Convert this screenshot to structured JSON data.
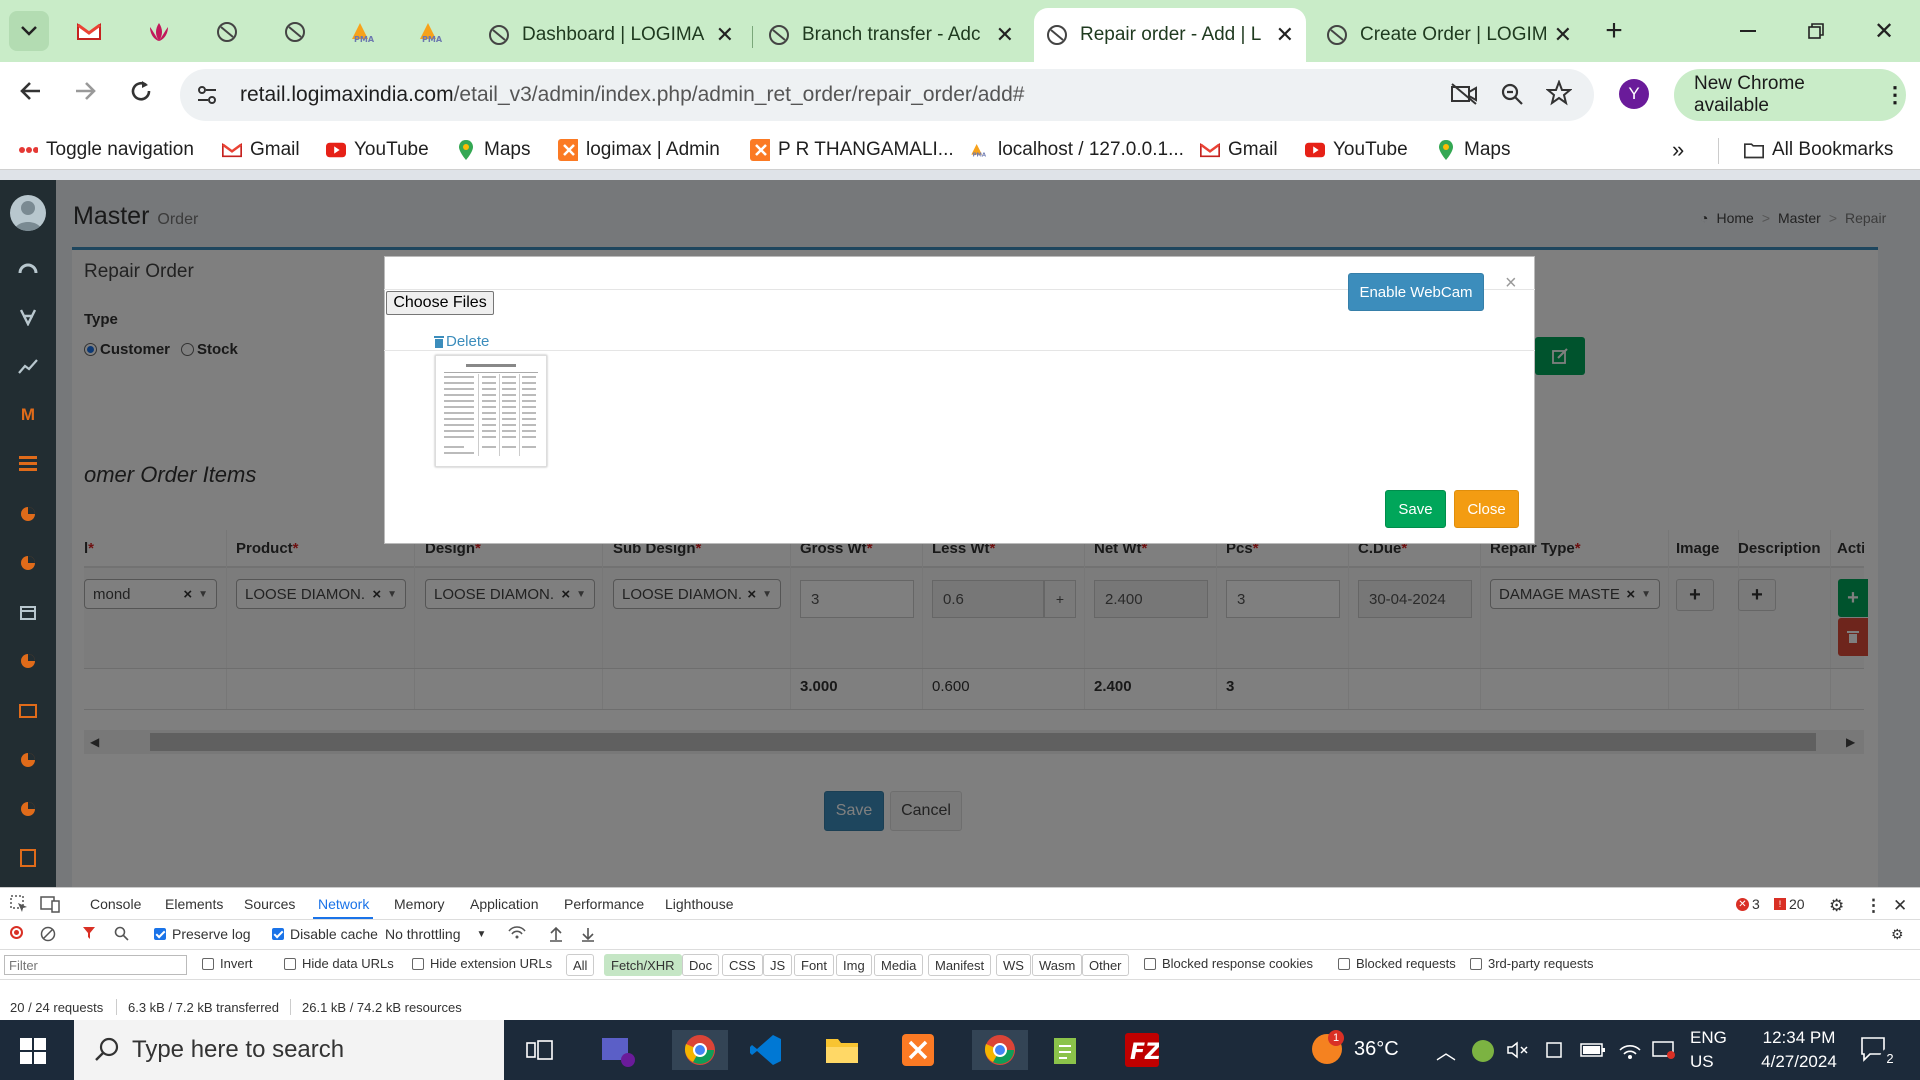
{
  "browser": {
    "tabs": [
      {
        "label": "Dashboard | LOGIMA",
        "active": false
      },
      {
        "label": "Branch transfer - Adc",
        "active": false
      },
      {
        "label": "Repair order - Add | L",
        "active": true
      },
      {
        "label": "Create Order | LOGIM",
        "active": false
      }
    ],
    "url_host": "retail.logimaxindia.com",
    "url_path": "/etail_v3/admin/index.php/admin_ret_order/repair_order/add#",
    "profile_initial": "Y",
    "new_chrome_label": "New Chrome available",
    "bookmarks": [
      "Toggle navigation",
      "Gmail",
      "YouTube",
      "Maps",
      "logimax | Admin",
      "P R THANGAMALI...",
      "localhost / 127.0.0.1...",
      "Gmail",
      "YouTube",
      "Maps"
    ],
    "all_bookmarks_label": "All Bookmarks",
    "colors": {
      "tabbar": "#c9ecc8",
      "accent": "#3c8dbc"
    }
  },
  "page": {
    "title": "Master",
    "subtitle": "Order",
    "breadcrumb": [
      "Home",
      "Master",
      "Repair"
    ],
    "box_title": "Repair Order",
    "type_label": "Type",
    "type_options": [
      "Customer",
      "Stock"
    ],
    "type_selected": "Customer",
    "items_title": "omer Order Items",
    "save_label": "Save",
    "cancel_label": "Cancel"
  },
  "table": {
    "headers": [
      {
        "label": "l",
        "required": true
      },
      {
        "label": "Product",
        "required": true
      },
      {
        "label": "Design",
        "required": true
      },
      {
        "label": "Sub Design",
        "required": true
      },
      {
        "label": "Gross Wt",
        "required": true
      },
      {
        "label": "Less Wt",
        "required": true
      },
      {
        "label": "Net Wt",
        "required": true
      },
      {
        "label": "Pcs",
        "required": true
      },
      {
        "label": "C.Due",
        "required": true
      },
      {
        "label": "Repair Type",
        "required": true
      },
      {
        "label": "Image",
        "required": false
      },
      {
        "label": "Description",
        "required": false
      },
      {
        "label": "Acti",
        "required": false
      }
    ],
    "row": {
      "material": "mond",
      "product": "LOOSE DIAMON...",
      "design": "LOOSE DIAMON...",
      "sub_design": "LOOSE DIAMON...",
      "gross_wt": "3",
      "less_wt": "0.6",
      "net_wt": "2.400",
      "pcs": "3",
      "c_due": "30-04-2024",
      "repair_type": "DAMAGE MASTER"
    },
    "totals": {
      "gross_wt": "3.000",
      "less_wt": "0.600",
      "net_wt": "2.400",
      "pcs": "3"
    }
  },
  "modal": {
    "choose_files_label": "Choose Files",
    "enable_webcam_label": "Enable WebCam",
    "close_x": "×",
    "delete_label": "Delete",
    "save_label": "Save",
    "close_label": "Close"
  },
  "devtools": {
    "tabs": [
      "Console",
      "Elements",
      "Sources",
      "Network",
      "Memory",
      "Application",
      "Performance",
      "Lighthouse"
    ],
    "active_tab": "Network",
    "errors": "3",
    "warnings": "20",
    "preserve_log": "Preserve log",
    "disable_cache": "Disable cache",
    "throttling": "No throttling",
    "filter_placeholder": "Filter",
    "invert": "Invert",
    "hide_data_urls": "Hide data URLs",
    "hide_extension_urls": "Hide extension URLs",
    "type_chips": [
      "All",
      "Fetch/XHR",
      "Doc",
      "CSS",
      "JS",
      "Font",
      "Img",
      "Media",
      "Manifest",
      "WS",
      "Wasm",
      "Other"
    ],
    "active_chip": "Fetch/XHR",
    "blocked_cookies": "Blocked response cookies",
    "blocked_requests": "Blocked requests",
    "third_party": "3rd-party requests",
    "status_requests": "20 / 24 requests",
    "status_transferred": "6.3 kB / 7.2 kB transferred",
    "status_resources": "26.1 kB / 74.2 kB resources"
  },
  "taskbar": {
    "search_placeholder": "Type here to search",
    "temperature": "36°C",
    "weather_badge": "1",
    "lang": "ENG",
    "region": "US",
    "time": "12:34 PM",
    "date": "4/27/2024",
    "notifications": "2"
  }
}
